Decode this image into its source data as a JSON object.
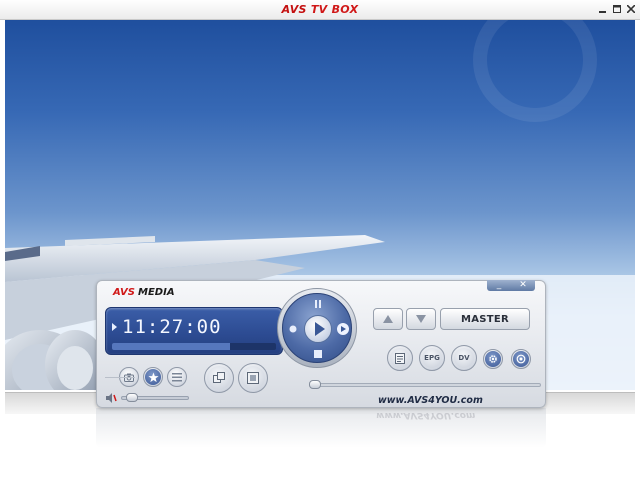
{
  "window": {
    "title_brand": "AVS",
    "title_rest": "TV BOX",
    "controls": {
      "minimize_icon": "minimize-icon",
      "maximize_icon": "maximize-icon",
      "close_icon": "close-icon"
    }
  },
  "player": {
    "brand_avs": "AVS",
    "brand_media": "MEDIA",
    "mini_minimize": "_",
    "mini_close": "✕",
    "time_display": "11:27:00",
    "progress": 0.72,
    "buttons": {
      "epg_label": "EPG",
      "dv_label": "DV",
      "master_label": "MASTER",
      "channel_up_icon": "triangle-up-icon",
      "channel_down_icon": "triangle-down-icon"
    },
    "volume_level": 0.05,
    "seek_position": 0.0,
    "url": "www.AVS4YOU.com"
  }
}
